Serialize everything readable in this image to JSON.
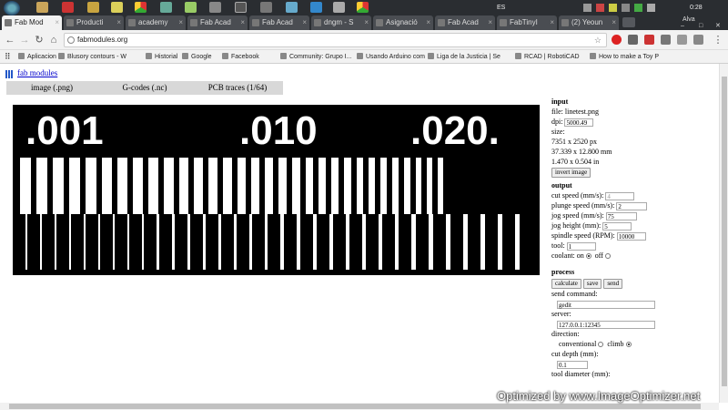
{
  "taskbar": {
    "language": "ES",
    "clock": "0:28",
    "user": "Alva"
  },
  "tabs": [
    {
      "label": "Fab Mod",
      "active": true
    },
    {
      "label": "Producti",
      "active": false
    },
    {
      "label": "academy",
      "active": false
    },
    {
      "label": "Fab Acad",
      "active": false
    },
    {
      "label": "Fab Acad",
      "active": false
    },
    {
      "label": "dngm - S",
      "active": false
    },
    {
      "label": "Asignació",
      "active": false
    },
    {
      "label": "Fab Acad",
      "active": false
    },
    {
      "label": "FabTinyI",
      "active": false
    },
    {
      "label": "(2) Yeoun",
      "active": false
    }
  ],
  "address": {
    "url": "fabmodules.org"
  },
  "bookmarks": [
    "Aplicaciones",
    "Blusory contours - W",
    "Historial",
    "Google",
    "Facebook",
    "Community: Grupo I...",
    "Usando Arduino com",
    "Liga de la Justicia | Se",
    "RCAD | RobotiCAD",
    "How to make a Toy P"
  ],
  "header": {
    "link": "fab modules"
  },
  "modes": [
    "image (.png)",
    "G-codes (.nc)",
    "PCB traces (1/64)"
  ],
  "canvas": {
    "labels": [
      ".001",
      ".010",
      ".020."
    ]
  },
  "input": {
    "title": "input",
    "file": "file: linetest.png",
    "dpi_label": "dpi:",
    "dpi": "5000.49",
    "size_label": "size:",
    "size_px": "7351 x 2520 px",
    "size_mm": "37.339 x 12.800 mm",
    "size_in": "1.470 x 0.504 in",
    "invert": "invert image"
  },
  "output": {
    "title": "output",
    "cut_speed_label": "cut speed (mm/s):",
    "cut_speed": "4",
    "plunge_speed_label": "plunge speed (mm/s):",
    "plunge_speed": "2",
    "jog_speed_label": "jog speed (mm/s):",
    "jog_speed": "75",
    "jog_height_label": "jog height (mm):",
    "jog_height": "5",
    "spindle_label": "spindle speed (RPM):",
    "spindle": "10000",
    "tool_label": "tool:",
    "tool": "1",
    "coolant_label": "coolant:",
    "on_label": "on",
    "off_label": "off"
  },
  "process": {
    "title": "process",
    "calculate": "calculate",
    "save": "save",
    "send": "send",
    "send_command_label": "send command:",
    "send_command": "gedit",
    "server_label": "server:",
    "server": "127.0.0.1:12345",
    "direction_label": "direction:",
    "conventional_label": "conventional",
    "climb_label": "climb",
    "cut_depth_label": "cut depth (mm):",
    "cut_depth": "0.1",
    "tool_diameter_label": "tool diameter (mm):"
  },
  "watermark": "Optimized by www.ImageOptimizer.net"
}
